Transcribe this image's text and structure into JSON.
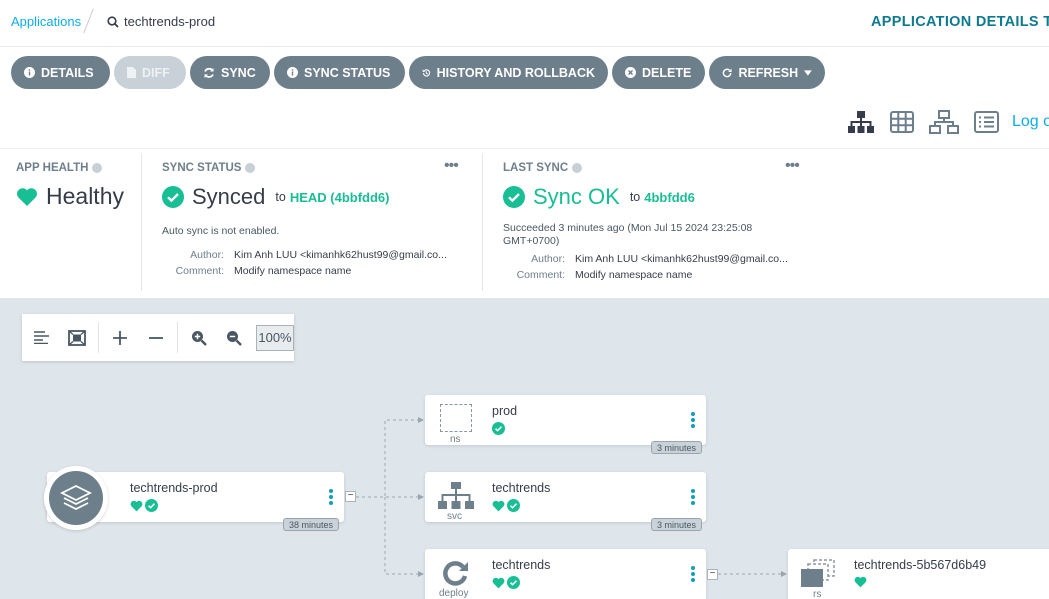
{
  "breadcrumb": {
    "applications": "Applications",
    "app_name": "techtrends-prod"
  },
  "header": {
    "title": "APPLICATION DETAILS TREE"
  },
  "toolbar_buttons": [
    {
      "label": "DETAILS",
      "icon": "info-circle-icon"
    },
    {
      "label": "DIFF",
      "icon": "file-icon",
      "disabled": true
    },
    {
      "label": "SYNC",
      "icon": "sync-icon"
    },
    {
      "label": "SYNC STATUS",
      "icon": "info-circle-icon"
    },
    {
      "label": "HISTORY AND ROLLBACK",
      "icon": "history-icon"
    },
    {
      "label": "DELETE",
      "icon": "times-circle-icon"
    },
    {
      "label": "REFRESH",
      "icon": "redo-icon",
      "dropdown": true
    }
  ],
  "view_modes": [
    "tree-view-icon",
    "pods-grid-icon",
    "network-view-icon",
    "list-view-icon"
  ],
  "log_link": "Log out",
  "app_health": {
    "label": "APP HEALTH",
    "value": "Healthy"
  },
  "sync_status": {
    "label": "SYNC STATUS",
    "value": "Synced",
    "to": "to",
    "target": "HEAD (4bbfdd6)",
    "auto_sync": "Auto sync is not enabled.",
    "author_label": "Author:",
    "author": "Kim Anh LUU <kimanhk62hust99@gmail.co...",
    "comment_label": "Comment:",
    "comment": "Modify namespace name"
  },
  "last_sync": {
    "label": "LAST SYNC",
    "value": "Sync OK",
    "to": "to",
    "revision": "4bbfdd6",
    "succeeded": "Succeeded 3 minutes ago (Mon Jul 15 2024 23:25:08",
    "tz": "GMT+0700)",
    "author_label": "Author:",
    "author": "Kim Anh LUU <kimanhk62hust99@gmail.co...",
    "comment_label": "Comment:",
    "comment": "Modify namespace name"
  },
  "graph": {
    "zoom": "100%",
    "app_node": {
      "name": "techtrends-prod",
      "age": "38 minutes"
    },
    "nodes": [
      {
        "name": "prod",
        "kind": "ns",
        "age": "3 minutes"
      },
      {
        "name": "techtrends",
        "kind": "svc",
        "age": "3 minutes"
      },
      {
        "name": "techtrends",
        "kind": "deploy"
      },
      {
        "name": "techtrends-5b567d6b49",
        "kind": "rs"
      }
    ]
  },
  "colors": {
    "accent": "#18be94",
    "link": "#0dadea",
    "button": "#6d7f8b",
    "title": "#0d7a8f"
  }
}
